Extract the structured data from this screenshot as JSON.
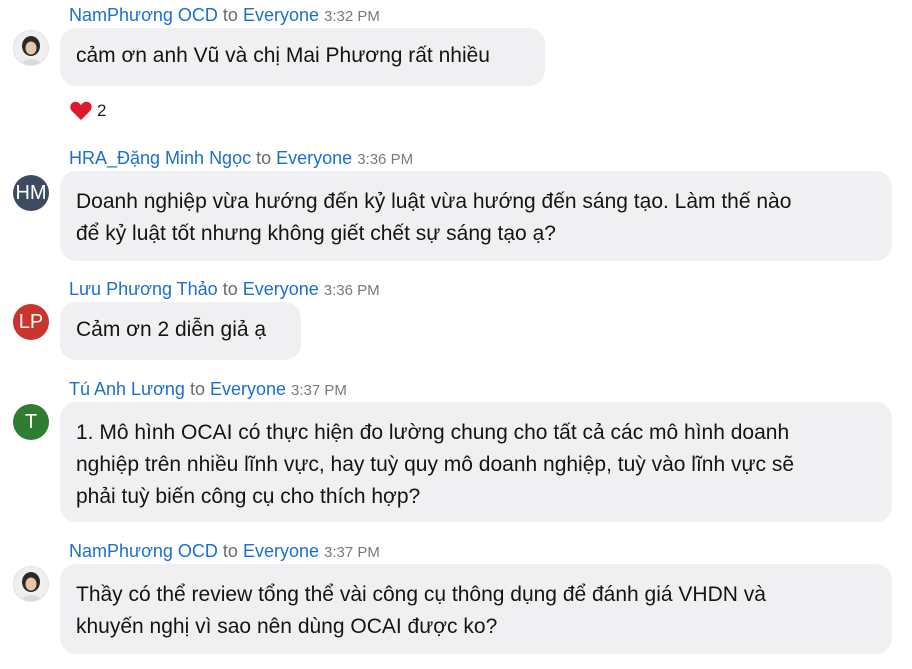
{
  "to_word": "to",
  "messages": [
    {
      "sender": "NamPhương OCD",
      "target": "Everyone",
      "time": "3:32 PM",
      "avatar": "photo",
      "lines": [
        "cảm ơn anh Vũ và chị Mai Phương rất nhiều"
      ],
      "reaction": {
        "icon": "heart-icon",
        "count": "2"
      }
    },
    {
      "sender": "HRA_Đặng Minh Ngọc",
      "target": "Everyone",
      "time": "3:36 PM",
      "avatar": "HM",
      "avatar_color": "#3c4b5f",
      "lines": [
        "Doanh nghiệp vừa hướng đến kỷ luật vừa hướng đến sáng tạo. Làm thế nào",
        "để kỷ luật tốt nhưng không giết chết sự sáng tạo ạ?"
      ]
    },
    {
      "sender": "Lưu Phương Thảo",
      "target": "Everyone",
      "time": "3:36 PM",
      "avatar": "LP",
      "avatar_color": "#c9352d",
      "lines": [
        "Cảm ơn 2 diễn giả ạ"
      ]
    },
    {
      "sender": "Tú Anh Lương",
      "target": "Everyone",
      "time": "3:37 PM",
      "avatar": "T",
      "avatar_color": "#2e7d32",
      "lines": [
        "1. Mô hình OCAI có thực hiện đo lường chung cho tất cả các mô hình doanh",
        "nghiệp trên nhiều lĩnh vực, hay tuỳ quy mô doanh nghiệp, tuỳ vào lĩnh vực sẽ",
        "phải tuỳ biến công cụ cho thích hợp?"
      ]
    },
    {
      "sender": "NamPhương OCD",
      "target": "Everyone",
      "time": "3:37 PM",
      "avatar": "photo",
      "lines": [
        "Thầy có thể review tổng thể vài công cụ thông dụng để đánh giá VHDN và",
        "khuyến nghị vì sao nên dùng OCAI được ko?"
      ]
    }
  ]
}
